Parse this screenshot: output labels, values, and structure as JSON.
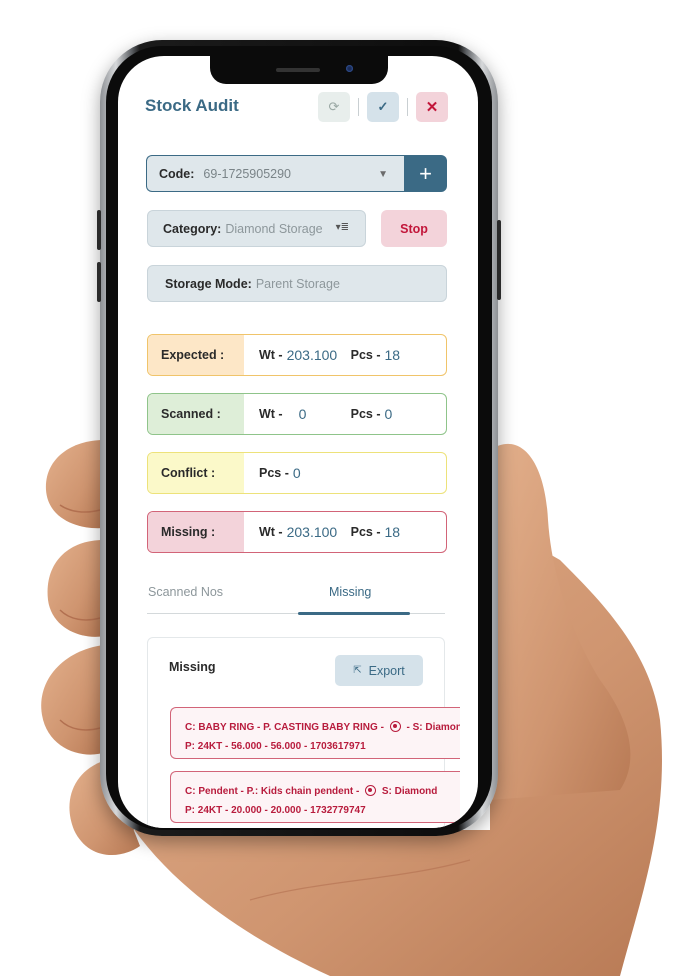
{
  "header": {
    "title": "Stock Audit",
    "refresh_icon": "refresh-icon",
    "confirm_icon": "check-icon",
    "close_icon": "close-icon",
    "refresh_glyph": "⟳",
    "confirm_glyph": "✓",
    "close_glyph": "✕"
  },
  "code": {
    "label": "Code:",
    "value": "69-1725905290",
    "caret_glyph": "▼",
    "add_glyph": "+"
  },
  "category": {
    "label": "Category:",
    "value": "Diamond Storage",
    "icon_glyph": "▾≣"
  },
  "stop_label": "Stop",
  "storage_mode": {
    "label": "Storage Mode:",
    "value": "Parent Storage"
  },
  "stats": {
    "expected": {
      "label": "Expected :",
      "wt_label": "Wt -",
      "wt": "203.100",
      "pcs_label": "Pcs -",
      "pcs": "18"
    },
    "scanned": {
      "label": "Scanned :",
      "wt_label": "Wt -",
      "wt": "0",
      "pcs_label": "Pcs -",
      "pcs": "0"
    },
    "conflict": {
      "label": "Conflict :",
      "pcs_label": "Pcs -",
      "pcs": "0"
    },
    "missing": {
      "label": "Missing :",
      "wt_label": "Wt -",
      "wt": "203.100",
      "pcs_label": "Pcs -",
      "pcs": "18"
    }
  },
  "tabs": [
    {
      "label": "Scanned Nos",
      "active": false
    },
    {
      "label": "Missing",
      "active": true
    }
  ],
  "panel": {
    "title": "Missing",
    "export_label": "Export",
    "export_glyph": "⇱",
    "items": [
      {
        "line1_a": "C: BABY RING - P. CASTING BABY RING -",
        "line1_b": "- S: Diamond",
        "line2": "P: 24KT - 56.000 - 56.000 - 1703617971"
      },
      {
        "line1_a": "C: Pendent - P.: Kids chain pendent -",
        "line1_b": "S: Diamond",
        "line2": "P: 24KT - 20.000 - 20.000 - 1732779747"
      }
    ]
  },
  "colors": {
    "accent": "#3b6a85",
    "danger": "#c2163a",
    "expected": "#f0c46a",
    "scanned": "#8fc48a",
    "conflict": "#ede27a",
    "missing": "#d26478"
  }
}
